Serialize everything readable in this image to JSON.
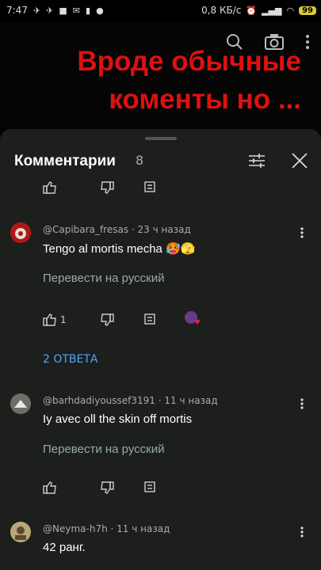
{
  "status": {
    "time": "7:47",
    "net_speed": "0,8 КБ/с",
    "battery": "99"
  },
  "video_overlay": {
    "line1": "Вроде обычные",
    "line2": "коменты но ..."
  },
  "sheet": {
    "title": "Комментарии",
    "count": "8"
  },
  "comments": [
    {
      "author": "@Capibara_fresas",
      "time": "23 ч назад",
      "text": "Tengo al mortis mecha 🥵🫣",
      "translate": "Перевести на русский",
      "likes": "1",
      "replies": "2 ОТВЕТА",
      "avatar_color": "#b01818"
    },
    {
      "author": "@barhdadiyoussef3191",
      "time": "11 ч назад",
      "text": "Iy avec oll the skin off mortis",
      "translate": "Перевести на русский",
      "avatar_color": "#6b6e66"
    },
    {
      "author": "@Neyma-h7h",
      "time": "11 ч назад",
      "text": "42 ранг.",
      "avatar_color": "#b8a878"
    }
  ],
  "colors": {
    "sheet_bg": "#1c1f1b",
    "overlay_text": "#e01010",
    "link": "#4ea4ff"
  }
}
